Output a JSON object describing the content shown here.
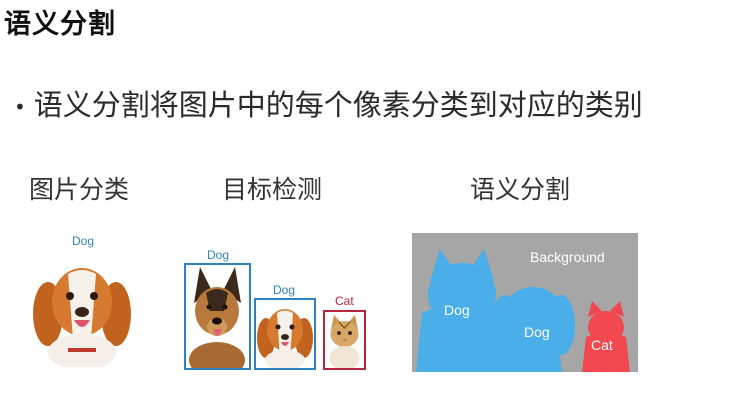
{
  "title": "语义分割",
  "bullet": "语义分割将图片中的每个像素分类到对应的类别",
  "columns": {
    "classification": {
      "heading": "图片分类",
      "label": "Dog"
    },
    "detection": {
      "heading": "目标检测",
      "labels": [
        "Dog",
        "Dog",
        "Cat"
      ]
    },
    "segmentation": {
      "heading": "语义分割",
      "background": "Background",
      "labels": [
        "Dog",
        "Dog",
        "Cat"
      ]
    }
  },
  "colors": {
    "detect_blue": "#2d82c1",
    "detect_red": "#b3263a",
    "seg_blue": "#4aaee8",
    "seg_red": "#f2484f",
    "seg_bg": "#a6a6a6"
  },
  "icons": [
    "bullet-dot-icon"
  ]
}
